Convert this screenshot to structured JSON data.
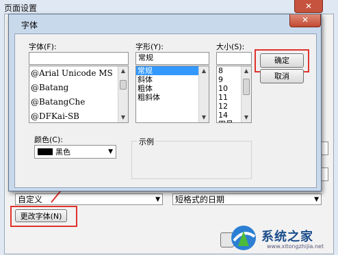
{
  "background_window": {
    "title": "页面设置",
    "close_glyph": "✕",
    "left_combo": "自定义",
    "right_combo": "短格式的日期",
    "change_font_button": "更改字体(N)"
  },
  "dialog": {
    "title": "字体",
    "close_glyph": "✕",
    "font": {
      "label": "字体(F):",
      "value": "",
      "items": [
        "@Arial Unicode MS",
        "@Batang",
        "@BatangChe",
        "@DFKai-SB"
      ]
    },
    "style": {
      "label": "字形(Y):",
      "value": "常规",
      "items": [
        "常规",
        "斜体",
        "粗体",
        "粗斜体"
      ],
      "selected_index": 0
    },
    "size": {
      "label": "大小(S):",
      "value": "",
      "items": [
        "8",
        "9",
        "10",
        "11",
        "12",
        "14",
        "四号"
      ]
    },
    "ok_button": "确定",
    "cancel_button": "取消",
    "color": {
      "label": "颜色(C):",
      "value": "黑色",
      "swatch": "#000000"
    },
    "sample": {
      "label": "示例"
    }
  },
  "watermark": {
    "text": "系统之家",
    "url": "www.xitongzhijia.net"
  },
  "colors": {
    "highlight_red": "#e0312b",
    "selection_blue": "#3399ff"
  }
}
